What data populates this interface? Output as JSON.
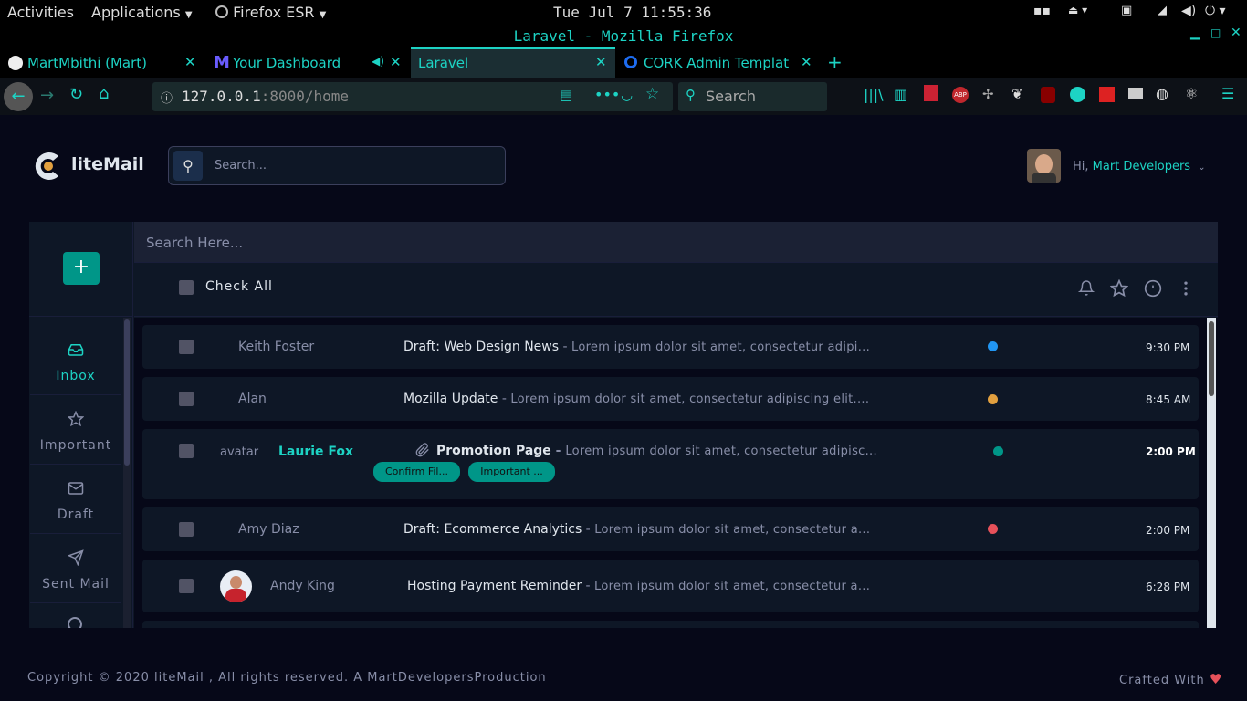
{
  "system": {
    "activities": "Activities",
    "applications": "Applications",
    "browser_menu": "Firefox ESR",
    "clock": "Tue Jul  7 11:55:36"
  },
  "window": {
    "title": "Laravel - Mozilla Firefox"
  },
  "tabs": [
    {
      "label": "MartMbithi (Mart)",
      "icon": "github-icon"
    },
    {
      "label": "Your Dashboard",
      "icon": "m-logo-icon"
    },
    {
      "label": "Laravel",
      "active": true
    },
    {
      "label": "CORK Admin Template",
      "icon": "cork-icon"
    }
  ],
  "urlbar": {
    "host": "127.0.0.1",
    "rest": ":8000/home",
    "search_placeholder": "Search"
  },
  "app": {
    "brand": "liteMail",
    "search_placeholder": "Search...",
    "greeting": "Hi,",
    "user_name": "Mart Developers",
    "mail_search_placeholder": "Search Here...",
    "check_all": "Check All",
    "sidebar": [
      {
        "label": "Inbox",
        "icon": "inbox-icon",
        "active": true
      },
      {
        "label": "Important",
        "icon": "star-icon"
      },
      {
        "label": "Draft",
        "icon": "mail-icon"
      },
      {
        "label": "Sent Mail",
        "icon": "send-icon"
      }
    ],
    "mails": [
      {
        "sender": "Keith Foster",
        "subject": "Draft: Web Design News",
        "preview": "Lorem ipsum dolor sit amet, consectetur adipi...",
        "time": "9:30 PM",
        "dot": "#2196f3"
      },
      {
        "sender": "Alan",
        "subject": "Mozilla Update",
        "preview": "Lorem ipsum dolor sit amet, consectetur adipiscing elit....",
        "time": "8:45 AM",
        "dot": "#e2a03f"
      },
      {
        "avatar_text": "avatar",
        "sender": "Laurie Fox",
        "subject": "Promotion Page",
        "preview": "Lorem ipsum dolor sit amet, consectetur adipisc...",
        "time": "2:00 PM",
        "dot": "#009688",
        "tags": [
          "Confirm Fil...",
          "Important ..."
        ]
      },
      {
        "sender": "Amy Diaz",
        "subject": "Draft: Ecommerce Analytics",
        "preview": "Lorem ipsum dolor sit amet, consectetur a...",
        "time": "2:00 PM",
        "dot": "#e7515a"
      },
      {
        "sender": "Andy King",
        "subject": "Hosting Payment Reminder",
        "preview": "Lorem ipsum dolor sit amet, consectetur a...",
        "time": "6:28 PM"
      }
    ],
    "footer": "Copyright © 2020 liteMail , All rights reserved. A MartDevelopersProduction",
    "crafted": "Crafted With"
  },
  "colors": {
    "accent": "#1dd3c4",
    "bg": "#060818",
    "card": "#0e1726",
    "heart": "#e7515a"
  }
}
